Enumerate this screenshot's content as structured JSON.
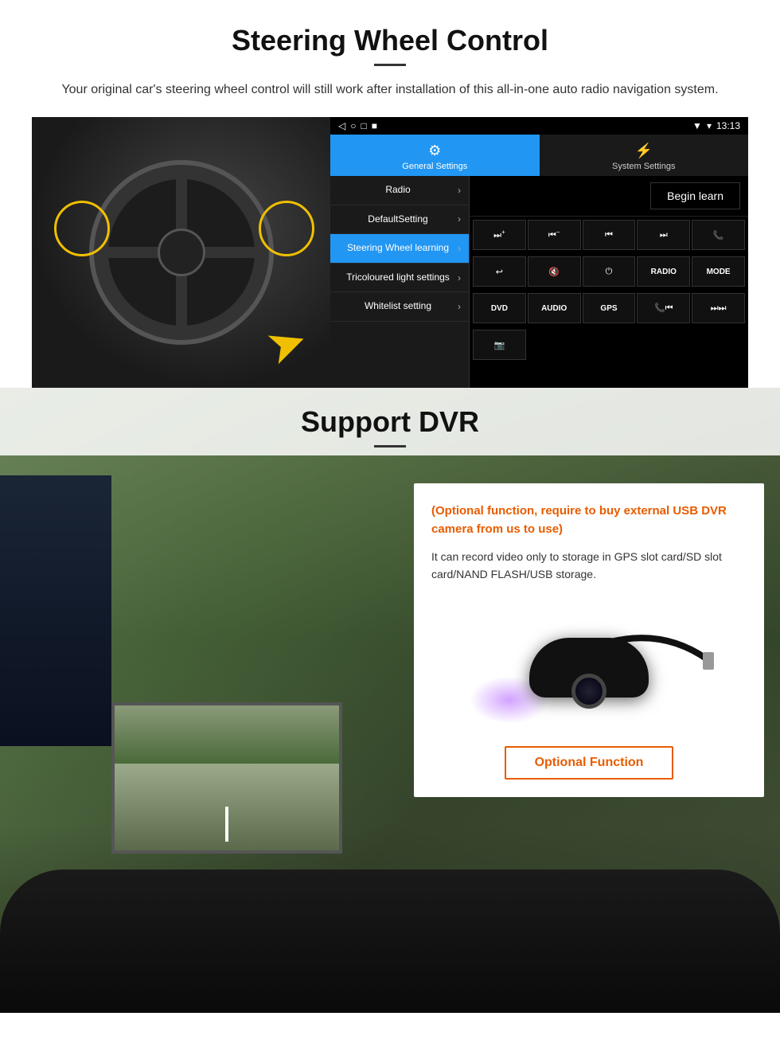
{
  "steering": {
    "title": "Steering Wheel Control",
    "subtitle": "Your original car's steering wheel control will still work after installation of this all-in-one auto radio navigation system.",
    "divider": "—",
    "statusbar": {
      "time": "13:13",
      "signal": "▼",
      "wifi": "▾"
    },
    "nav_buttons": [
      "◁",
      "○",
      "□",
      "■"
    ],
    "tabs": [
      {
        "label": "General Settings",
        "icon": "⚙",
        "active": true
      },
      {
        "label": "System Settings",
        "icon": "⚡",
        "active": false
      }
    ],
    "menu_items": [
      {
        "label": "Radio",
        "active": false
      },
      {
        "label": "DefaultSetting",
        "active": false
      },
      {
        "label": "Steering Wheel learning",
        "active": true
      },
      {
        "label": "Tricoloured light settings",
        "active": false
      },
      {
        "label": "Whitelist setting",
        "active": false
      }
    ],
    "begin_learn": "Begin learn",
    "control_buttons_row1": [
      {
        "icon": "⏭+",
        "label": ""
      },
      {
        "icon": "⏮−",
        "label": ""
      },
      {
        "icon": "⏮",
        "label": ""
      },
      {
        "icon": "⏭",
        "label": ""
      },
      {
        "icon": "📞",
        "label": ""
      }
    ],
    "control_buttons_row2": [
      {
        "icon": "↩",
        "label": ""
      },
      {
        "icon": "🔇",
        "label": ""
      },
      {
        "icon": "⏻",
        "label": ""
      },
      {
        "icon": "RADIO",
        "label": ""
      },
      {
        "icon": "MODE",
        "label": ""
      }
    ],
    "control_buttons_row3": [
      {
        "icon": "DVD",
        "label": ""
      },
      {
        "icon": "AUDIO",
        "label": ""
      },
      {
        "icon": "GPS",
        "label": ""
      },
      {
        "icon": "📞⏮",
        "label": ""
      },
      {
        "icon": "⏭⏭",
        "label": ""
      }
    ],
    "control_buttons_row4": [
      {
        "icon": "📷",
        "label": ""
      }
    ]
  },
  "dvr": {
    "title": "Support DVR",
    "optional_text": "(Optional function, require to buy external USB DVR camera from us to use)",
    "desc_text": "It can record video only to storage in GPS slot card/SD slot card/NAND FLASH/USB storage.",
    "optional_button_label": "Optional Function"
  }
}
